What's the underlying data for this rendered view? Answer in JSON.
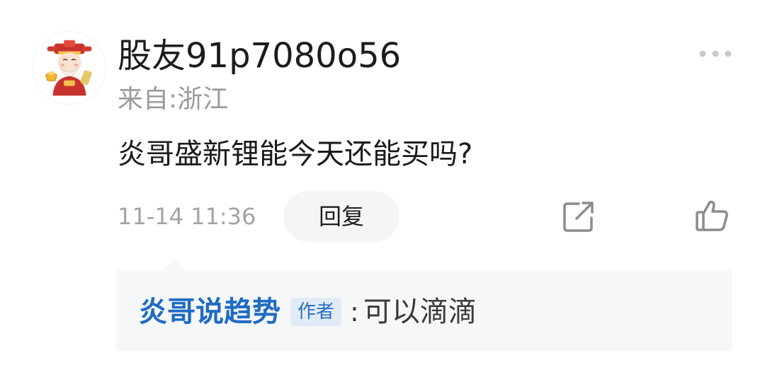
{
  "comment": {
    "avatar_icon": "fortune-god-avatar",
    "username": "股友91p7080o56",
    "location": "来自:浙江",
    "text": "炎哥盛新锂能今天还能买吗?",
    "timestamp": "11-14 11:36",
    "reply_label": "回复",
    "more_icon": "more-dots-icon",
    "share_icon": "share-icon",
    "like_icon": "thumbs-up-icon"
  },
  "author_reply": {
    "author": "炎哥说趋势",
    "badge": "作者",
    "separator": ":",
    "text": "可以滴滴"
  },
  "colors": {
    "author_blue": "#1f6bc4",
    "muted_gray": "#9a9a9a",
    "reply_bg": "#f6f7f9",
    "badge_bg": "#e1ebf8"
  }
}
